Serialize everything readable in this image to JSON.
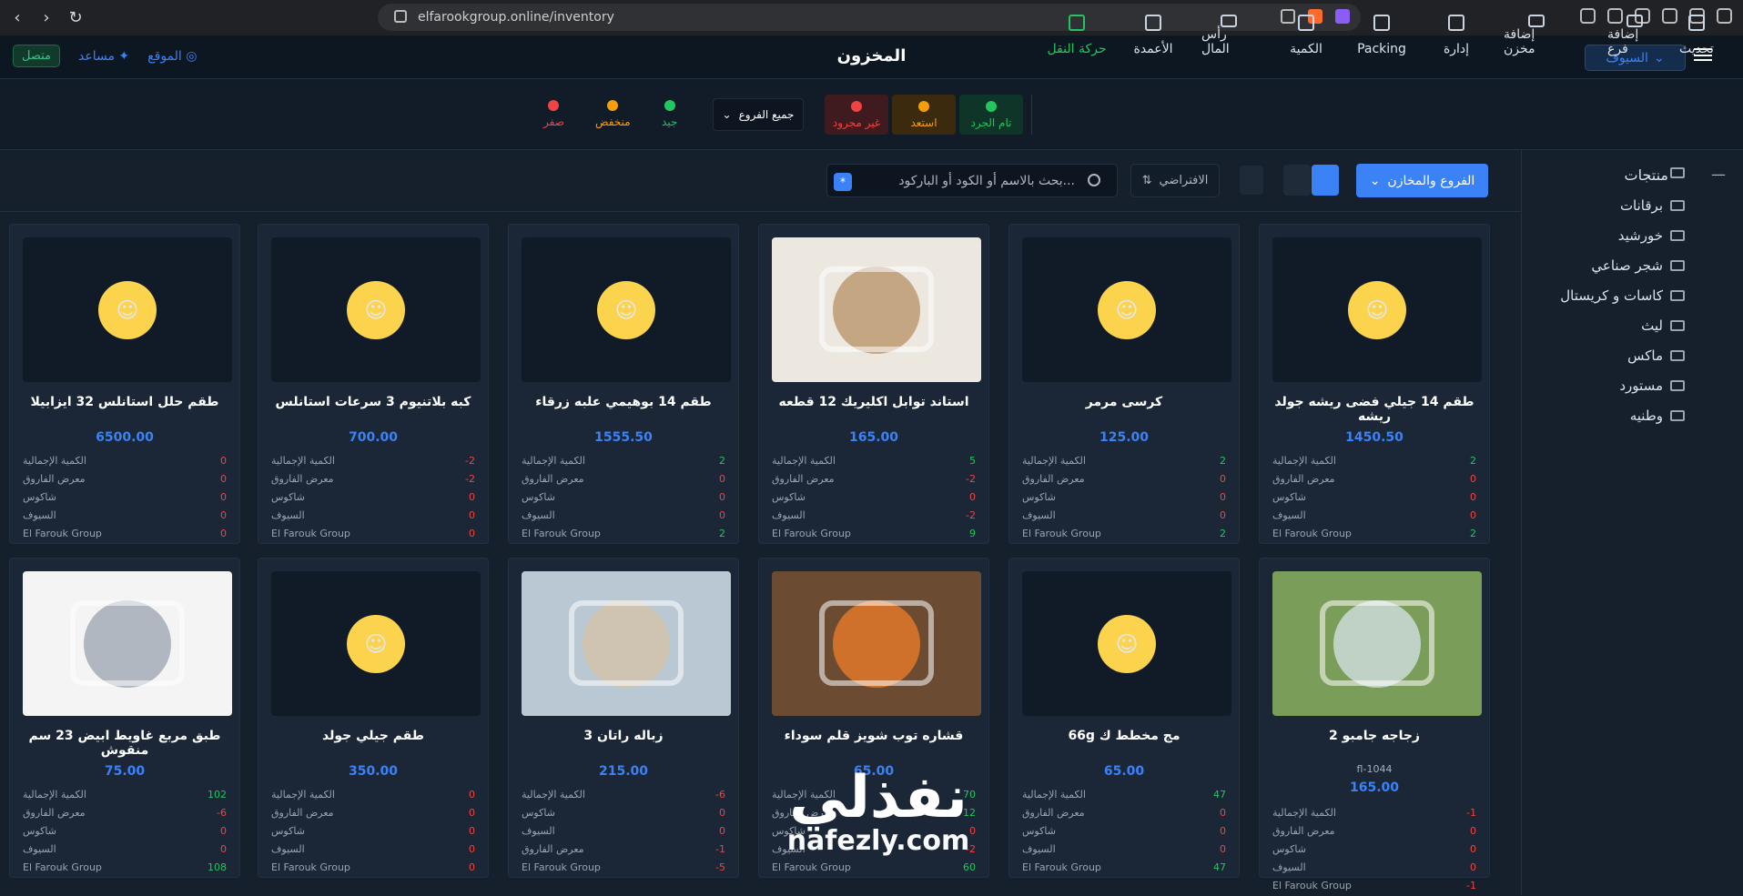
{
  "browser": {
    "url": "elfarookgroup.online/inventory"
  },
  "header": {
    "title": "المخزون",
    "branch_label": "السيوف",
    "status": "متصل",
    "help": "مساعد",
    "site": "الموقع"
  },
  "toolbar": {
    "tools": [
      "تحديث",
      "إضافة فرع",
      "إضافة مخزن",
      "إدارة",
      "Packing",
      "الكمية",
      "رأس المال",
      "الأعمدة",
      "حركة النقل"
    ],
    "states": [
      {
        "label": "تام الجرد",
        "color": "#22c55e"
      },
      {
        "label": "استعد",
        "color": "#f59e0b"
      },
      {
        "label": "غير مجرود",
        "color": "#ef4444"
      }
    ],
    "branch_select": "جميع الفروع",
    "legend": [
      {
        "label": "جيد",
        "color": "#22c55e"
      },
      {
        "label": "منخفض",
        "color": "#f59e0b"
      },
      {
        "label": "صفر",
        "color": "#ef4444"
      }
    ]
  },
  "sidebar": {
    "title": "منتجات",
    "items": [
      "برقانات",
      "خورشيد",
      "شجر صناعي",
      "كاسات و كريستال",
      "ليث",
      "ماكس",
      "مستورد",
      "وطنيه"
    ]
  },
  "filters": {
    "branches_button": "الفروع والمخازن",
    "search_placeholder": "بحث بالاسم أو الكود أو الباركود...",
    "sort": "الافتراضي"
  },
  "products": [
    {
      "name": "طقم حلل استانلس 32 ايزابيلا",
      "price": "6500.00",
      "image": "placeholder",
      "rows": [
        [
          "الكمية الإجمالية",
          "0",
          "red"
        ],
        [
          "معرض الفاروق",
          "0",
          "red"
        ],
        [
          "شاكوس",
          "0",
          "red"
        ],
        [
          "السيوف",
          "0",
          "red"
        ],
        [
          "El Farouk Group",
          "0",
          "red"
        ]
      ]
    },
    {
      "name": "كبه بلاتنيوم 3 سرعات استانلس",
      "price": "700.00",
      "image": "placeholder",
      "rows": [
        [
          "الكمية الإجمالية",
          "-2",
          "red"
        ],
        [
          "معرض الفاروق",
          "-2",
          "red"
        ],
        [
          "شاكوس",
          "0",
          "red"
        ],
        [
          "السيوف",
          "0",
          "red"
        ],
        [
          "El Farouk Group",
          "0",
          "red"
        ]
      ]
    },
    {
      "name": "طقم 14 بوهيمي علبه زرقاء",
      "price": "1555.50",
      "image": "placeholder",
      "rows": [
        [
          "الكمية الإجمالية",
          "2",
          "green"
        ],
        [
          "معرض الفاروق",
          "0",
          "red"
        ],
        [
          "شاكوس",
          "0",
          "red"
        ],
        [
          "السيوف",
          "0",
          "red"
        ],
        [
          "El Farouk Group",
          "2",
          "green"
        ]
      ]
    },
    {
      "name": "استاند توابل اكليريك 12 قطعه",
      "price": "165.00",
      "image": "spices",
      "rows": [
        [
          "الكمية الإجمالية",
          "5",
          "green"
        ],
        [
          "معرض الفاروق",
          "-2",
          "red"
        ],
        [
          "شاكوس",
          "0",
          "red"
        ],
        [
          "السيوف",
          "-2",
          "red"
        ],
        [
          "El Farouk Group",
          "9",
          "green"
        ]
      ]
    },
    {
      "name": "كرسى مرمر",
      "price": "125.00",
      "image": "placeholder",
      "rows": [
        [
          "الكمية الإجمالية",
          "2",
          "green"
        ],
        [
          "معرض الفاروق",
          "0",
          "red"
        ],
        [
          "شاكوس",
          "0",
          "red"
        ],
        [
          "السيوف",
          "0",
          "red"
        ],
        [
          "El Farouk Group",
          "2",
          "green"
        ]
      ]
    },
    {
      "name": "طقم 14 جيلي فضى ريشه جولد ريشه",
      "price": "1450.50",
      "image": "placeholder",
      "rows": [
        [
          "الكمية الإجمالية",
          "2",
          "green"
        ],
        [
          "معرض الفاروق",
          "0",
          "red"
        ],
        [
          "شاكوس",
          "0",
          "red"
        ],
        [
          "السيوف",
          "0",
          "red"
        ],
        [
          "El Farouk Group",
          "2",
          "green"
        ]
      ]
    },
    {
      "name": "طبق مربع غاويط ابيض 23 سم منقوش",
      "price": "75.00",
      "image": "plate",
      "rows": [
        [
          "الكمية الإجمالية",
          "102",
          "green"
        ],
        [
          "معرض الفاروق",
          "-6",
          "red"
        ],
        [
          "شاكوس",
          "0",
          "red"
        ],
        [
          "السيوف",
          "0",
          "red"
        ],
        [
          "El Farouk Group",
          "108",
          "green"
        ]
      ]
    },
    {
      "name": "طقم جيلي جولد",
      "price": "350.00",
      "image": "placeholder",
      "rows": [
        [
          "الكمية الإجمالية",
          "0",
          "red"
        ],
        [
          "معرض الفاروق",
          "0",
          "red"
        ],
        [
          "شاكوس",
          "0",
          "red"
        ],
        [
          "السيوف",
          "0",
          "red"
        ],
        [
          "El Farouk Group",
          "0",
          "red"
        ]
      ]
    },
    {
      "name": "زباله راتان 3",
      "price": "215.00",
      "image": "bin",
      "rows": [
        [
          "الكمية الإجمالية",
          "-6",
          "red"
        ],
        [
          "شاكوس",
          "0",
          "red"
        ],
        [
          "السيوف",
          "0",
          "red"
        ],
        [
          "معرض الفاروق",
          "-1",
          "red"
        ],
        [
          "El Farouk Group",
          "-5",
          "red"
        ]
      ]
    },
    {
      "name": "قشاره توب شويز قلم سوداء",
      "price": "65.00",
      "image": "peeler",
      "rows": [
        [
          "الكمية الإجمالية",
          "70",
          "green"
        ],
        [
          "معرض الفاروق",
          "12",
          "green"
        ],
        [
          "شاكوس",
          "0",
          "red"
        ],
        [
          "السيوف",
          "-2",
          "red"
        ],
        [
          "El Farouk Group",
          "60",
          "green"
        ]
      ]
    },
    {
      "name": "مج مخطط ك 66g",
      "price": "65.00",
      "image": "placeholder",
      "rows": [
        [
          "الكمية الإجمالية",
          "47",
          "green"
        ],
        [
          "معرض الفاروق",
          "0",
          "red"
        ],
        [
          "شاكوس",
          "0",
          "red"
        ],
        [
          "السيوف",
          "0",
          "red"
        ],
        [
          "El Farouk Group",
          "47",
          "green"
        ]
      ]
    },
    {
      "name": "زجاجه جامبو 2",
      "code": "fl-1044",
      "price": "165.00",
      "image": "bottle",
      "rows": [
        [
          "الكمية الإجمالية",
          "-1",
          "red"
        ],
        [
          "معرض الفاروق",
          "0",
          "red"
        ],
        [
          "شاكوس",
          "0",
          "red"
        ],
        [
          "السيوف",
          "0",
          "red"
        ],
        [
          "El Farouk Group",
          "-1",
          "red"
        ]
      ]
    }
  ],
  "watermark": {
    "arabic": "نفذلي",
    "latin": "nafezly.com"
  }
}
